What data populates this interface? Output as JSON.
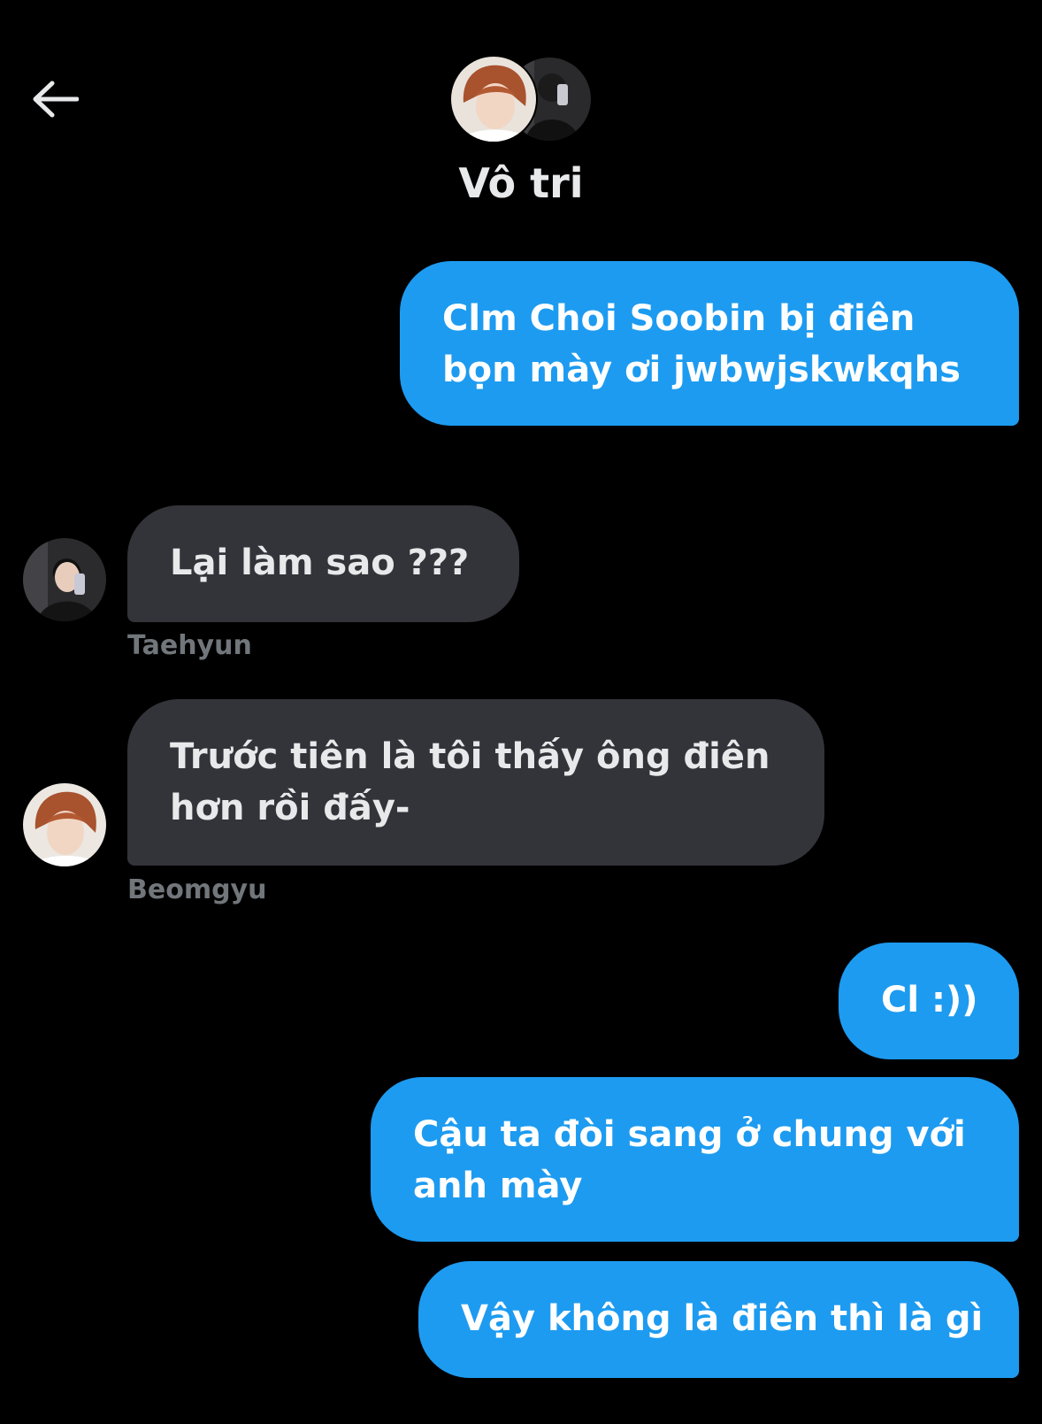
{
  "header": {
    "back_icon": "arrow-left-icon",
    "title": "Vô tri",
    "avatars": [
      "group-member-avatar-beomgyu",
      "group-member-avatar-taehyun"
    ]
  },
  "colors": {
    "background": "#000000",
    "outgoing_bubble": "#1d9bf0",
    "incoming_bubble": "#333439",
    "primary_text": "#e7e9ea",
    "secondary_text": "#71767b"
  },
  "messages": [
    {
      "direction": "out",
      "text_lines": [
        "Clm Choi Soobin bị điên",
        "bọn mày ơi jwbwjskwkqhs"
      ]
    },
    {
      "direction": "in",
      "sender": "Taehyun",
      "text_lines": [
        "Lại làm sao ???"
      ]
    },
    {
      "direction": "in",
      "sender": "Beomgyu",
      "text_lines": [
        "Trước tiên là tôi thấy ông điên",
        "hơn rồi đấy-"
      ]
    },
    {
      "direction": "out",
      "text_lines": [
        "Cl :))"
      ]
    },
    {
      "direction": "out",
      "text_lines": [
        "Cậu ta đòi sang ở chung với",
        "anh mày"
      ]
    },
    {
      "direction": "out",
      "text_lines": [
        "Vậy không là điên thì là gì"
      ]
    }
  ]
}
